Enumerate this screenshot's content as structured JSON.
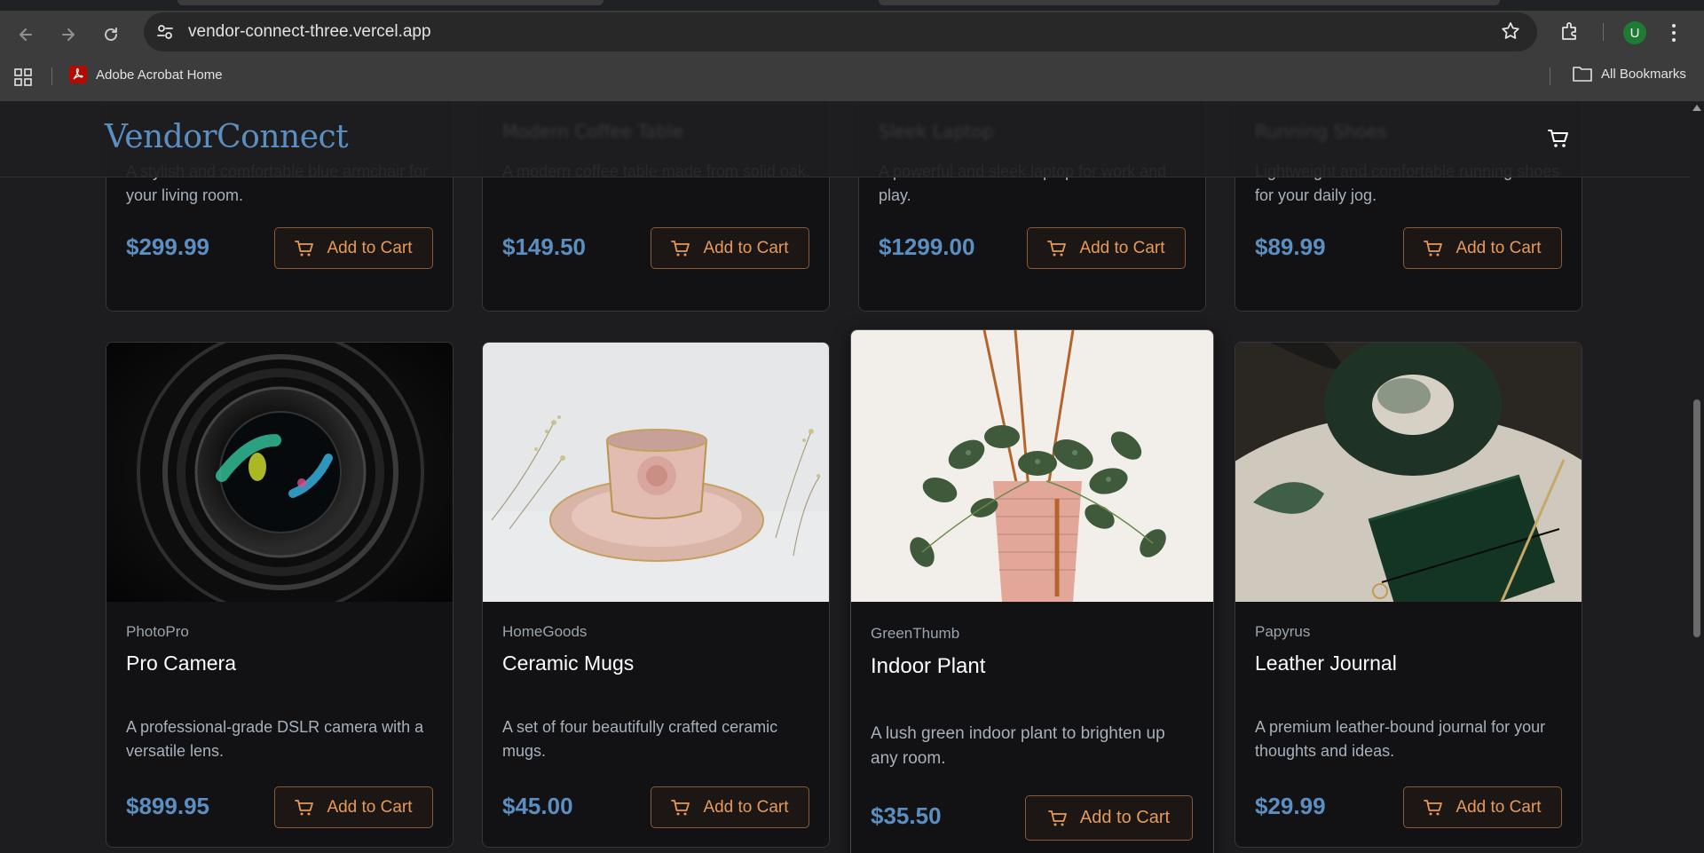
{
  "browser": {
    "url": "vendor-connect-three.vercel.app",
    "bookmark_item": "Adobe Acrobat Home",
    "all_bookmarks": "All Bookmarks",
    "profile_initial": "U"
  },
  "site": {
    "logo": "VendorConnect",
    "ghost_titles": [
      "Modern Coffee Table",
      "Sleek Laptop",
      "Running Shoes"
    ]
  },
  "products_top": [
    {
      "description": "A stylish and comfortable blue armchair for your living room.",
      "price": "$299.99",
      "button": "Add to Cart"
    },
    {
      "description": "A modern coffee table made from solid oak.",
      "price": "$149.50",
      "button": "Add to Cart"
    },
    {
      "description": "A powerful and sleek laptop for work and play.",
      "price": "$1299.00",
      "button": "Add to Cart"
    },
    {
      "description": "Lightweight and comfortable running shoes for your daily jog.",
      "price": "$89.99",
      "button": "Add to Cart"
    }
  ],
  "products": [
    {
      "vendor": "PhotoPro",
      "title": "Pro Camera",
      "description": "A professional-grade DSLR camera with a versatile lens.",
      "price": "$899.95",
      "button": "Add to Cart"
    },
    {
      "vendor": "HomeGoods",
      "title": "Ceramic Mugs",
      "description": "A set of four beautifully crafted ceramic mugs.",
      "price": "$45.00",
      "button": "Add to Cart"
    },
    {
      "vendor": "GreenThumb",
      "title": "Indoor Plant",
      "description": "A lush green indoor plant to brighten up any room.",
      "price": "$35.50",
      "button": "Add to Cart"
    },
    {
      "vendor": "Papyrus",
      "title": "Leather Journal",
      "description": "A premium leather-bound journal for your thoughts and ideas.",
      "price": "$29.99",
      "button": "Add to Cart"
    }
  ],
  "colors": {
    "accent_price": "#5b8fc2",
    "button_text": "#e59a5b",
    "button_border": "#8a5a34",
    "card_bg": "#121214",
    "page_bg": "#1d1d1f"
  },
  "icons": {
    "button_icon": "cart-icon",
    "header_icon": "cart-icon"
  }
}
